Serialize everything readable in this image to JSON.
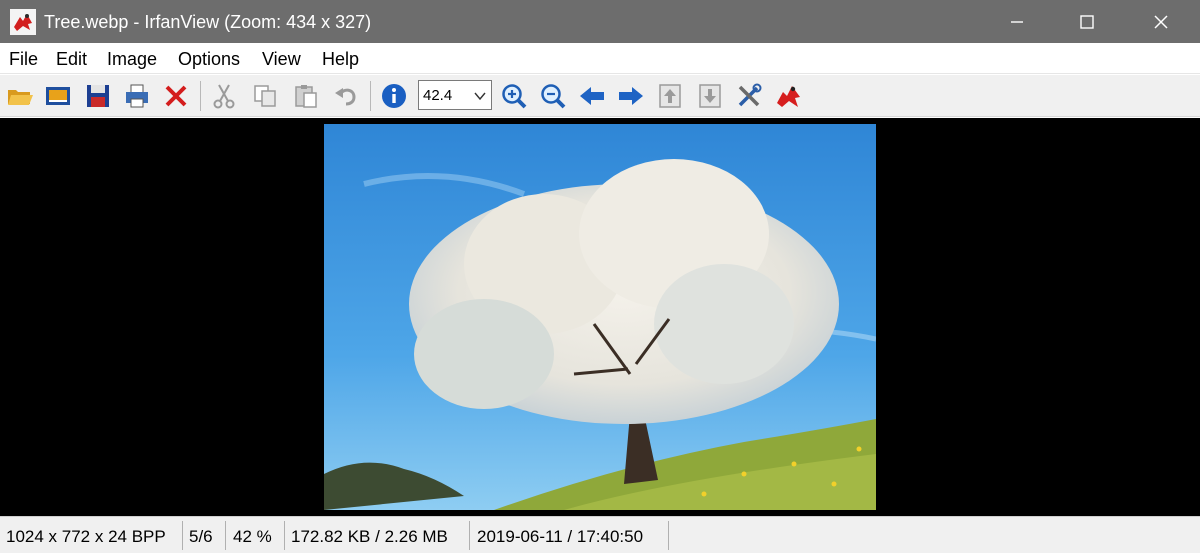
{
  "window": {
    "title": "Tree.webp - IrfanView (Zoom: 434 x 327)"
  },
  "menu": {
    "items": [
      "File",
      "Edit",
      "Image",
      "Options",
      "View",
      "Help"
    ]
  },
  "toolbar": {
    "buttons": [
      {
        "name": "open-icon"
      },
      {
        "name": "slideshow-icon"
      },
      {
        "name": "save-icon"
      },
      {
        "name": "print-icon"
      },
      {
        "name": "delete-icon"
      },
      {
        "name": "cut-icon"
      },
      {
        "name": "copy-icon"
      },
      {
        "name": "paste-icon"
      },
      {
        "name": "undo-icon"
      },
      {
        "name": "info-icon"
      },
      {
        "name": "zoom-in-icon"
      },
      {
        "name": "zoom-out-icon"
      },
      {
        "name": "previous-icon"
      },
      {
        "name": "next-icon"
      },
      {
        "name": "first-page-icon"
      },
      {
        "name": "last-page-icon"
      },
      {
        "name": "settings-icon"
      },
      {
        "name": "irfanview-logo-icon"
      }
    ],
    "zoom_value": "42.4"
  },
  "status": {
    "dimensions": "1024 x 772 x 24 BPP",
    "index": "5/6",
    "zoom": "42 %",
    "size": "172.82 KB / 2.26 MB",
    "datetime": "2019-06-11 / 17:40:50"
  },
  "colors": {
    "titlebar": "#6d6d6d",
    "toolbar": "#f0f0f0",
    "viewer_background": "#000000",
    "sky": "#3f9ae0",
    "grass": "#8fa83a"
  }
}
